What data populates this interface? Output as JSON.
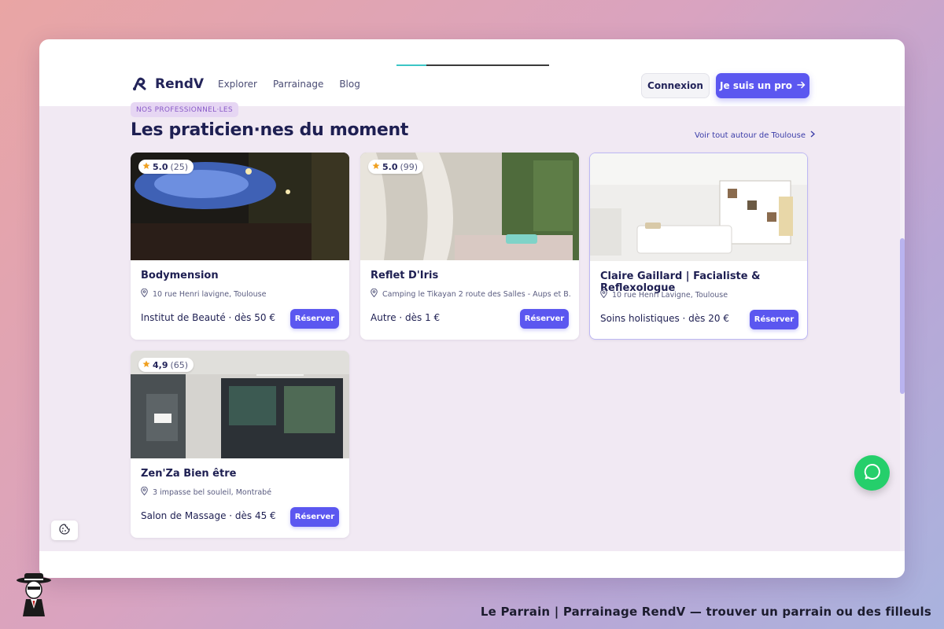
{
  "navbar": {
    "logo_text": "RendV",
    "links": [
      "Explorer",
      "Parrainage",
      "Blog"
    ],
    "login_label": "Connexion",
    "pro_label": "Je suis un pro"
  },
  "section": {
    "eyebrow": "NOS PROFESSIONNEL·LES",
    "title": "Les praticien·nes du moment",
    "see_all": "Voir tout autour de Toulouse"
  },
  "cards": [
    {
      "score": "5.0",
      "count": "(25)",
      "name": "Bodymension",
      "address": "10 rue Henri lavigne, Toulouse",
      "price": "Institut de Beauté · dès 50 €",
      "button": "Réserver"
    },
    {
      "score": "5.0",
      "count": "(99)",
      "name": "Reflet D'Iris",
      "address": "Camping le Tikayan 2 route des Salles - Aups et B...",
      "price": "Autre · dès 1 €",
      "button": "Réserver"
    },
    {
      "score": "",
      "count": "",
      "name": "Claire Gaillard | Facialiste & Reflexologue",
      "address": "10 rue Henri Lavigne, Toulouse",
      "price": "Soins holistiques · dès 20 €",
      "button": "Réserver"
    },
    {
      "score": "4,9",
      "count": "(65)",
      "name": "Zen'Za Bien être",
      "address": "3 impasse bel souleil, Montrabé",
      "price": "Salon de Massage · dès 45 €",
      "button": "Réserver"
    }
  ],
  "caption": "Le Parrain | Parrainage RendV — trouver un parrain ou des filleuls",
  "colors": {
    "accent": "#5b57f0",
    "heading": "#1e1f52",
    "whatsapp": "#25cf6b",
    "section_bg": "#f1e9f3"
  },
  "icons": [
    "rendv-logo-icon",
    "arrow-right-icon",
    "chevron-right-icon",
    "star-icon",
    "map-pin-icon",
    "whatsapp-icon",
    "cookie-icon",
    "mascot-icon"
  ]
}
